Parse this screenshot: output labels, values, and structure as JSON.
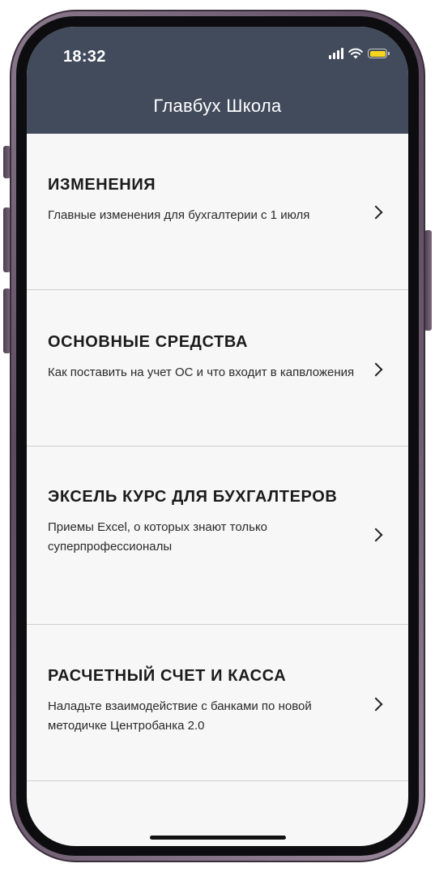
{
  "status_bar": {
    "time": "18:32",
    "icons": [
      "cellular-signal-icon",
      "wifi-icon",
      "battery-icon"
    ],
    "battery_color": "#f7d51c"
  },
  "header": {
    "title": "Главбух Школа",
    "background": "#414b5b"
  },
  "courses": [
    {
      "title": "ИЗМЕНЕНИЯ",
      "description": "Главные изменения для бухгалтерии с 1 июля",
      "icon": "chevron-right-icon"
    },
    {
      "title": "ОСНОВНЫЕ СРЕДСТВА",
      "description": "Как поставить на учет ОС и что входит в капвложения",
      "icon": "chevron-right-icon"
    },
    {
      "title": "ЭКСЕЛЬ КУРС ДЛЯ БУХГАЛТЕРОВ",
      "description": "Приемы Excel, о которых знают только суперпрофессионалы",
      "icon": "chevron-right-icon"
    },
    {
      "title": "РАСЧЕТНЫЙ СЧЕТ И КАССА",
      "description": "Наладьте взаимодействие с банками по новой методичке Центробанка 2.0",
      "icon": "chevron-right-icon"
    }
  ]
}
